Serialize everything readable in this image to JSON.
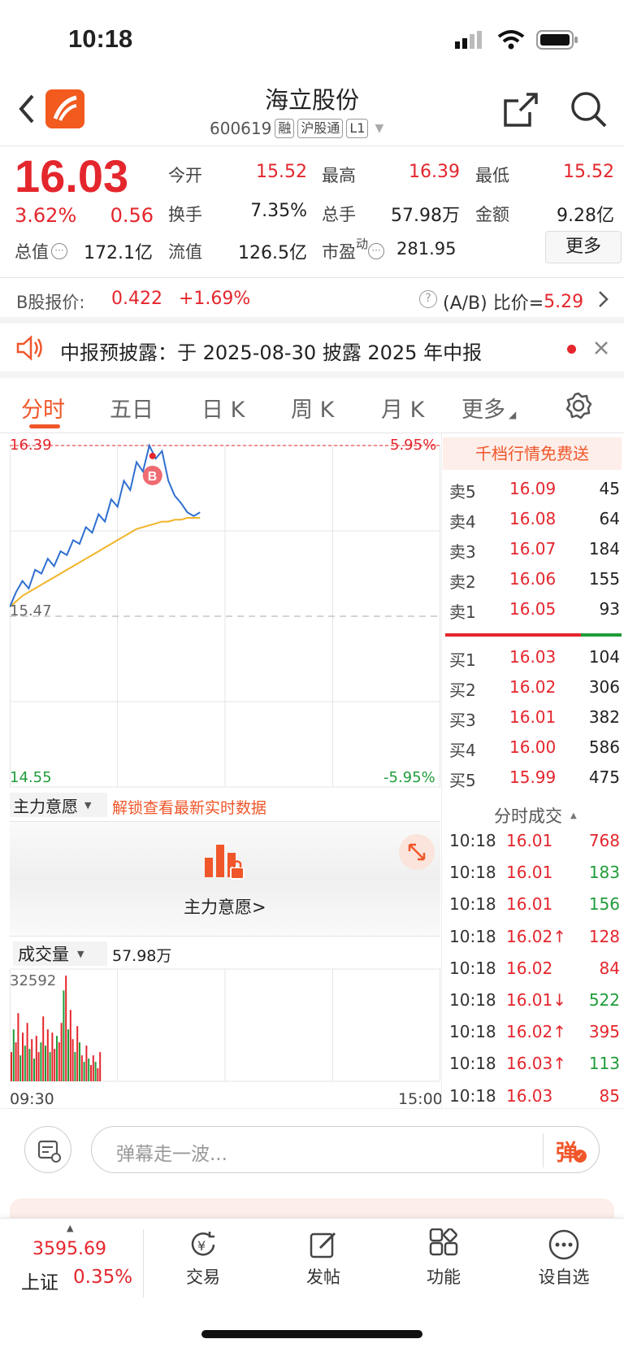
{
  "status_bar": {
    "time": "10:18"
  },
  "header": {
    "title": "海立股份",
    "code": "600619",
    "tags": [
      "融",
      "沪股通",
      "L1"
    ]
  },
  "quote": {
    "price": "16.03",
    "change_pct": "3.62%",
    "change": "0.56",
    "open_label": "今开",
    "open": "15.52",
    "high_label": "最高",
    "high": "16.39",
    "low_label": "最低",
    "low": "15.52",
    "turnover_label": "换手",
    "turnover": "7.35%",
    "volume_label": "总手",
    "volume": "57.98万",
    "amount_label": "金额",
    "amount": "9.28亿",
    "mktcap_label": "总值",
    "mktcap": "172.1亿",
    "float_label": "流值",
    "float_cap": "126.5亿",
    "pe_label": "市盈",
    "pe_sup": "动",
    "pe": "281.95",
    "more_button": "更多"
  },
  "b_share": {
    "label": "B股报价:",
    "price": "0.422",
    "change": "+1.69%",
    "ratio_label": "(A/B) 比价=",
    "ratio": "5.29"
  },
  "notice": {
    "text": "中报预披露：于 2025-08-30 披露 2025 年中报"
  },
  "tabs": [
    "分时",
    "五日",
    "日 K",
    "周 K",
    "月 K",
    "更多"
  ],
  "chart_data": {
    "type": "line",
    "title": "",
    "xlabel": "",
    "ylabel": "",
    "ylim": [
      14.55,
      16.39
    ],
    "y_top": "16.39",
    "y_mid": "15.47",
    "y_bottom": "14.55",
    "pct_top": "5.95%",
    "pct_bottom": "-5.95%",
    "x_start": "09:30",
    "x_end": "15:00",
    "marker": "B",
    "series": [
      {
        "values": [
          15.52,
          15.6,
          15.66,
          15.62,
          15.72,
          15.7,
          15.78,
          15.74,
          15.82,
          15.8,
          15.88,
          15.86,
          15.95,
          15.92,
          16.02,
          15.98,
          16.1,
          16.06,
          16.2,
          16.15,
          16.3,
          16.25,
          16.39,
          16.32,
          16.36,
          16.2,
          16.12,
          16.08,
          16.03,
          16.01,
          16.03
        ]
      },
      {
        "values": [
          15.52,
          15.55,
          15.58,
          15.6,
          15.62,
          15.64,
          15.66,
          15.68,
          15.7,
          15.72,
          15.74,
          15.76,
          15.78,
          15.8,
          15.82,
          15.84,
          15.86,
          15.88,
          15.9,
          15.92,
          15.94,
          15.95,
          15.96,
          15.97,
          15.98,
          15.98,
          15.99,
          15.99,
          16.0,
          16.0,
          16.0
        ]
      }
    ],
    "volume_max_label": "32592",
    "volume": [
      9000,
      16000,
      12000,
      21000,
      8000,
      15000,
      11000,
      18000,
      10000,
      13000,
      7000,
      14000,
      9000,
      12000,
      20000,
      11000,
      16000,
      9000,
      15000,
      10000,
      14000,
      12000,
      18000,
      28000,
      32592,
      16000,
      22000,
      13000,
      9000,
      17000,
      12000,
      8000,
      6000,
      11000,
      7000,
      5000,
      8000,
      6000,
      4000,
      9000
    ],
    "volume_up": [
      true,
      false,
      true,
      true,
      false,
      true,
      false,
      true,
      false,
      true,
      false,
      true,
      true,
      false,
      true,
      false,
      true,
      false,
      true,
      true,
      false,
      true,
      true,
      false,
      true,
      false,
      true,
      true,
      false,
      true,
      false,
      true,
      false,
      true,
      false,
      true,
      true,
      false,
      true,
      true
    ]
  },
  "main_force": {
    "dropdown": "主力意愿",
    "unlock": "解锁查看最新实时数据",
    "card_label": "主力意愿>"
  },
  "volume_panel": {
    "dropdown": "成交量",
    "value": "57.98万"
  },
  "order_book": {
    "promo": "千档行情免费送",
    "asks": [
      {
        "label": "卖5",
        "price": "16.09",
        "qty": "45"
      },
      {
        "label": "卖4",
        "price": "16.08",
        "qty": "64"
      },
      {
        "label": "卖3",
        "price": "16.07",
        "qty": "184"
      },
      {
        "label": "卖2",
        "price": "16.06",
        "qty": "155"
      },
      {
        "label": "卖1",
        "price": "16.05",
        "qty": "93"
      }
    ],
    "bids": [
      {
        "label": "买1",
        "price": "16.03",
        "qty": "104"
      },
      {
        "label": "买2",
        "price": "16.02",
        "qty": "306"
      },
      {
        "label": "买3",
        "price": "16.01",
        "qty": "382"
      },
      {
        "label": "买4",
        "price": "16.00",
        "qty": "586"
      },
      {
        "label": "买5",
        "price": "15.99",
        "qty": "475"
      }
    ],
    "ticks_title": "分时成交",
    "ticks": [
      {
        "time": "10:18",
        "price": "16.01",
        "qty": "768",
        "dir": "up"
      },
      {
        "time": "10:18",
        "price": "16.01",
        "qty": "183",
        "dir": "down"
      },
      {
        "time": "10:18",
        "price": "16.01",
        "qty": "156",
        "dir": "down"
      },
      {
        "time": "10:18",
        "price": "16.02↑",
        "qty": "128",
        "dir": "up"
      },
      {
        "time": "10:18",
        "price": "16.02",
        "qty": "84",
        "dir": "up"
      },
      {
        "time": "10:18",
        "price": "16.01↓",
        "qty": "522",
        "dir": "down"
      },
      {
        "time": "10:18",
        "price": "16.02↑",
        "qty": "395",
        "dir": "up"
      },
      {
        "time": "10:18",
        "price": "16.03↑",
        "qty": "113",
        "dir": "down"
      },
      {
        "time": "10:18",
        "price": "16.03",
        "qty": "85",
        "dir": "up"
      }
    ]
  },
  "comment": {
    "placeholder": "弹幕走一波...",
    "danmu_label": "弹"
  },
  "bottom_nav": {
    "index_value": "3595.69",
    "index_name": "上证",
    "index_change": "0.35%",
    "items": [
      "交易",
      "发帖",
      "功能",
      "设自选"
    ]
  },
  "colors": {
    "up": "#e4262d",
    "down": "#1f9d3a",
    "accent": "#f0562a",
    "price_line": "#2f6fd0",
    "avg_line": "#f0b428"
  }
}
